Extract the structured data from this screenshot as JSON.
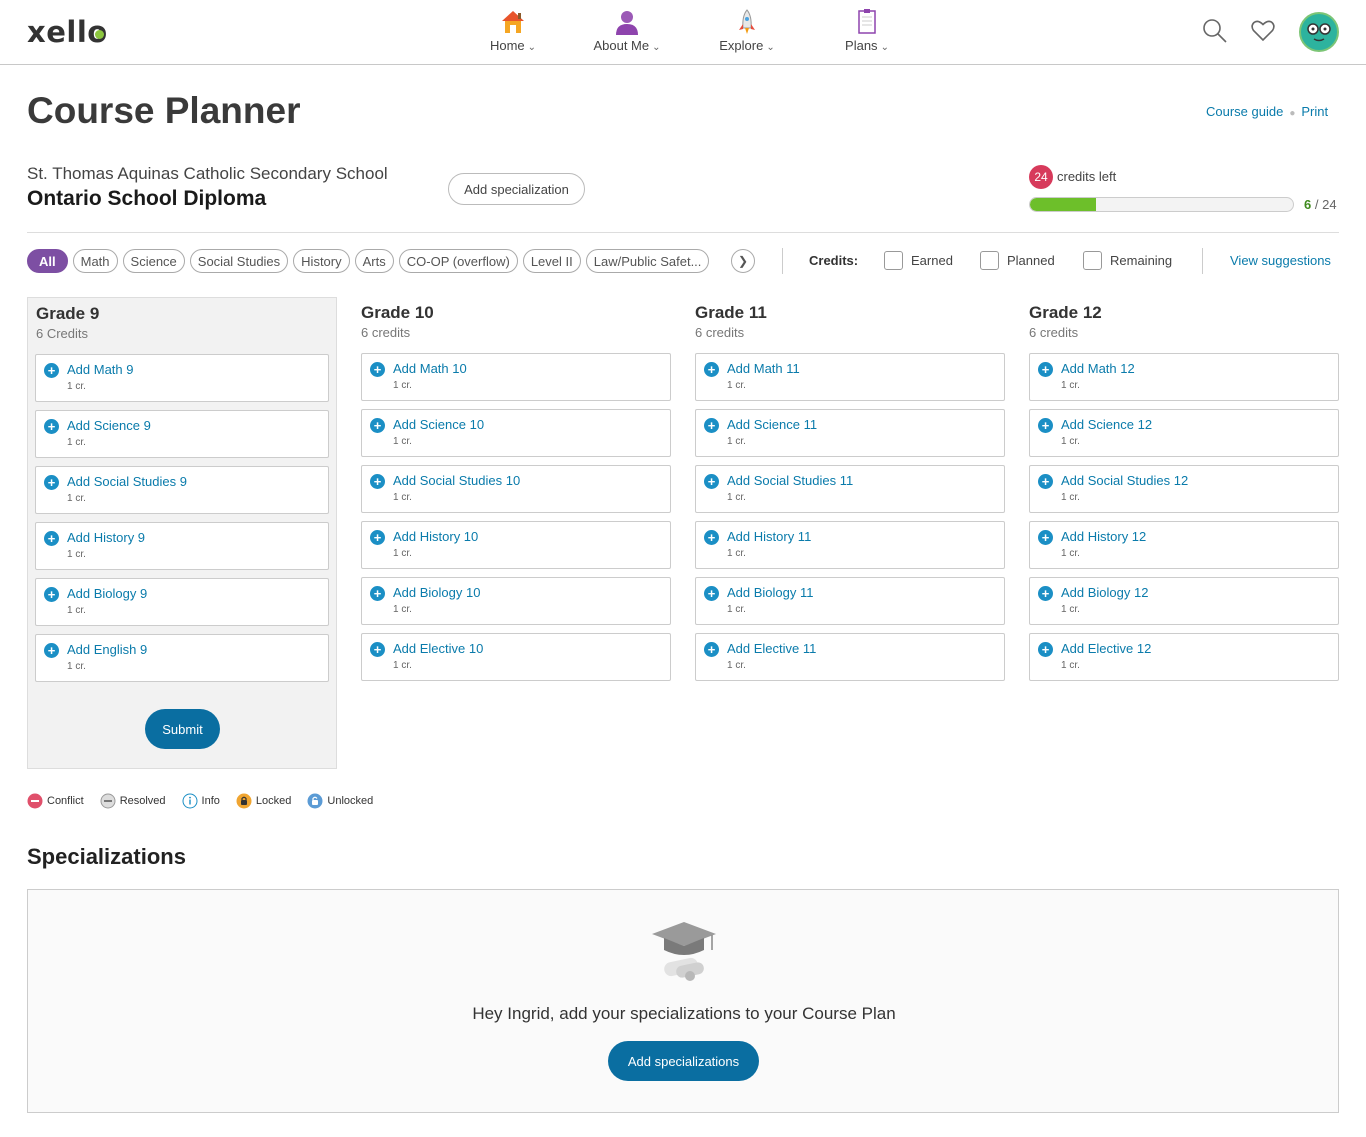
{
  "nav": {
    "logo_text": "xello",
    "items": [
      {
        "label": "Home",
        "icon": "house-icon"
      },
      {
        "label": "About Me",
        "icon": "person-icon"
      },
      {
        "label": "Explore",
        "icon": "rocket-icon"
      },
      {
        "label": "Plans",
        "icon": "clipboard-icon"
      }
    ],
    "right_icons": [
      "search-icon",
      "heart-icon",
      "avatar"
    ]
  },
  "header": {
    "title": "Course Planner",
    "course_guide_link": "Course guide",
    "print_link": "Print",
    "school_name": "St. Thomas Aquinas Catholic Secondary School",
    "diploma_name": "Ontario School Diploma",
    "add_specialization_label": "Add specialization",
    "credits_left_count": "24",
    "credits_left_label": "credits left",
    "progress": {
      "current": "6",
      "total": "/ 24",
      "fraction": 0.25
    }
  },
  "filters": {
    "chips": [
      "All",
      "Math",
      "Science",
      "Social Studies",
      "History",
      "Arts",
      "CO-OP (overflow)",
      "Level II",
      "Law/Public Safet..."
    ],
    "active": "All",
    "credits_label": "Credits:",
    "checkboxes": [
      "Earned",
      "Planned",
      "Remaining"
    ],
    "view_suggestions": "View suggestions"
  },
  "grades": [
    {
      "title": "Grade 9",
      "credits": "6 Credits",
      "courses": [
        {
          "name": "Add Math 9",
          "credits": "1 cr."
        },
        {
          "name": "Add Science 9",
          "credits": "1 cr."
        },
        {
          "name": "Add Social Studies 9",
          "credits": "1 cr."
        },
        {
          "name": "Add History 9",
          "credits": "1 cr."
        },
        {
          "name": "Add Biology 9",
          "credits": "1 cr."
        },
        {
          "name": "Add English 9",
          "credits": "1 cr."
        }
      ],
      "submit_label": "Submit"
    },
    {
      "title": "Grade 10",
      "credits": "6 credits",
      "courses": [
        {
          "name": "Add Math 10",
          "credits": "1 cr."
        },
        {
          "name": "Add Science 10",
          "credits": "1 cr."
        },
        {
          "name": "Add Social Studies 10",
          "credits": "1 cr."
        },
        {
          "name": "Add History 10",
          "credits": "1 cr."
        },
        {
          "name": "Add Biology 10",
          "credits": "1 cr."
        },
        {
          "name": "Add Elective 10",
          "credits": "1 cr."
        }
      ]
    },
    {
      "title": "Grade 11",
      "credits": "6 credits",
      "courses": [
        {
          "name": "Add Math 11",
          "credits": "1 cr."
        },
        {
          "name": "Add Science 11",
          "credits": "1 cr."
        },
        {
          "name": "Add Social Studies 11",
          "credits": "1 cr."
        },
        {
          "name": "Add History 11",
          "credits": "1 cr."
        },
        {
          "name": "Add Biology 11",
          "credits": "1 cr."
        },
        {
          "name": "Add Elective 11",
          "credits": "1 cr."
        }
      ]
    },
    {
      "title": "Grade 12",
      "credits": "6 credits",
      "courses": [
        {
          "name": "Add Math 12",
          "credits": "1 cr."
        },
        {
          "name": "Add Science 12",
          "credits": "1 cr."
        },
        {
          "name": "Add Social Studies 12",
          "credits": "1 cr."
        },
        {
          "name": "Add History 12",
          "credits": "1 cr."
        },
        {
          "name": "Add Biology 12",
          "credits": "1 cr."
        },
        {
          "name": "Add Elective 12",
          "credits": "1 cr."
        }
      ]
    }
  ],
  "legend": [
    {
      "label": "Conflict",
      "icon": "conflict-icon",
      "color": "#e0506b"
    },
    {
      "label": "Resolved",
      "icon": "resolved-icon",
      "color": "#999999"
    },
    {
      "label": "Info",
      "icon": "info-icon",
      "color": "#1b8fc5"
    },
    {
      "label": "Locked",
      "icon": "lock-icon",
      "color": "#f0a531"
    },
    {
      "label": "Unlocked",
      "icon": "unlock-icon",
      "color": "#5b9bd5"
    }
  ],
  "specializations": {
    "title": "Specializations",
    "message": "Hey Ingrid, add your specializations to your Course Plan",
    "button_label": "Add specializations",
    "illustration": "graduation-cap-icon"
  },
  "colors": {
    "accent": "#0a7bab",
    "primary_button": "#0a6ea1",
    "active_chip": "#7d4fa3",
    "progress_fill": "#6dbf2a",
    "credits_badge": "#d73a5b"
  }
}
